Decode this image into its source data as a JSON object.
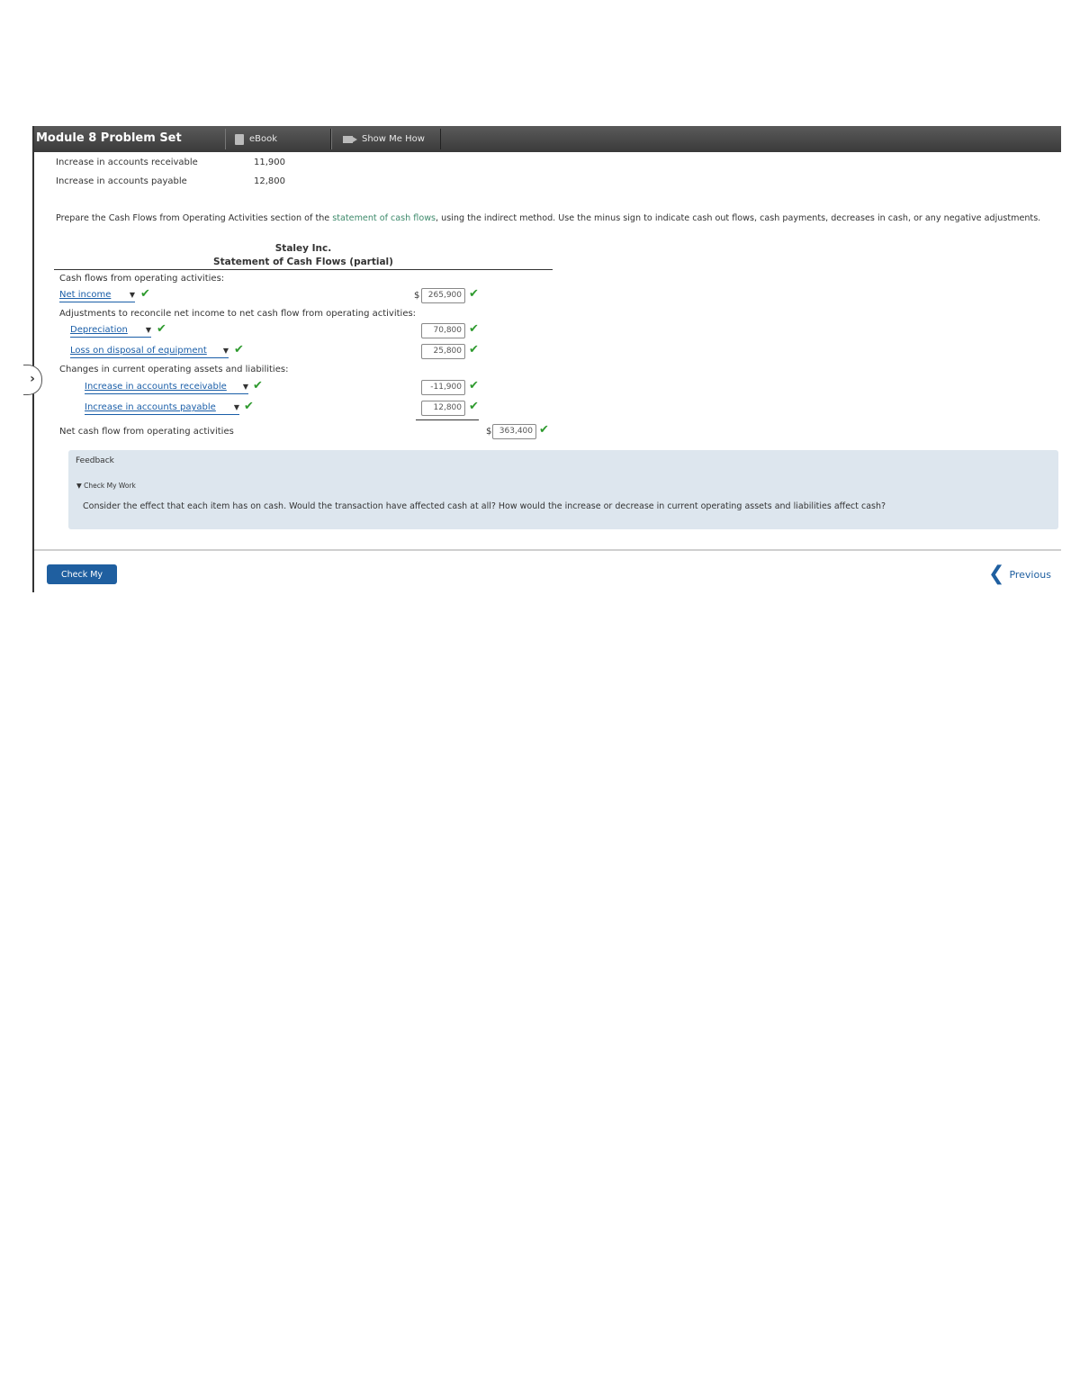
{
  "header": {
    "title": "Module 8 Problem Set",
    "ebook_label": "eBook",
    "show_me_how_label": "Show Me How"
  },
  "given": [
    {
      "label": "Increase in accounts receivable",
      "value": "11,900"
    },
    {
      "label": "Increase in accounts payable",
      "value": "12,800"
    }
  ],
  "instructions": {
    "before": "Prepare the Cash Flows from Operating Activities section of the ",
    "link": "statement of cash flows",
    "after": ", using the indirect method. Use the minus sign to indicate cash out flows, cash payments, decreases in cash, or any negative adjustments."
  },
  "statement": {
    "company": "Staley Inc.",
    "title": "Statement of Cash Flows (partial)",
    "section_label": "Cash flows from operating activities:",
    "net_income": {
      "select": "Net income",
      "dollar": "$",
      "amount": "265,900"
    },
    "adjustments_label": "Adjustments to reconcile net income to net cash flow from operating activities:",
    "depreciation": {
      "select": "Depreciation",
      "amount": "70,800"
    },
    "loss": {
      "select": "Loss on disposal of equipment",
      "amount": "25,800"
    },
    "changes_label": "Changes in current operating assets and liabilities:",
    "ar": {
      "select": "Increase in accounts receivable",
      "amount": "-11,900"
    },
    "ap": {
      "select": "Increase in accounts payable",
      "amount": "12,800"
    },
    "net_cash_label": "Net cash flow from operating activities",
    "net_cash": {
      "dollar": "$",
      "amount": "363,400"
    }
  },
  "feedback": {
    "heading": "Feedback",
    "toggle": "▼ Check My Work",
    "text": "Consider the effect that each item has on cash. Would the transaction have affected cash at all? How would the increase or decrease in current operating assets and liabilities affect cash?"
  },
  "footer": {
    "check_button": "Check My Work",
    "previous": "Previous"
  },
  "icons": {
    "check": "check-icon",
    "dropdown": "chevron-down-icon",
    "previous": "chevron-left-icon",
    "sidebar": "chevron-right-icon"
  },
  "colors": {
    "accent": "#1f5fa0",
    "check": "#2e9a2e",
    "feedback_bg": "#dde6ee",
    "link": "#3d8a6b"
  }
}
